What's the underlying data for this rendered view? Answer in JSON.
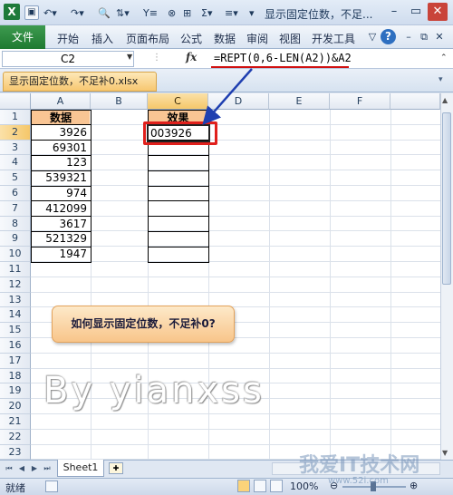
{
  "window": {
    "title": "显示固定位数，不足...",
    "app_icon": "excel-logo",
    "qa_icons": [
      "save-icon",
      "undo-icon",
      "redo-icon",
      "print-preview-icon",
      "sort-icon",
      "filter-icon",
      "borders-icon",
      "autosum-icon",
      "merge-icon"
    ]
  },
  "ribbon": {
    "file": "文件",
    "tabs": [
      "开始",
      "插入",
      "页面布局",
      "公式",
      "数据",
      "审阅",
      "视图",
      "开发工具"
    ]
  },
  "formula_bar": {
    "name_box": "C2",
    "fx": "fx",
    "formula": "=REPT(0,6-LEN(A2))&A2"
  },
  "workbook_tab": "显示固定位数，不足补0.xlsx",
  "columns": [
    "A",
    "B",
    "C",
    "D",
    "E",
    "F"
  ],
  "rows": [
    "1",
    "2",
    "3",
    "4",
    "5",
    "6",
    "7",
    "8",
    "9",
    "10",
    "11",
    "12",
    "13",
    "14",
    "15",
    "16",
    "17",
    "18",
    "19",
    "20",
    "21",
    "22",
    "23"
  ],
  "sheet": {
    "header_a": "数据",
    "header_c": "效果",
    "data": [
      "3926",
      "69301",
      "123",
      "539321",
      "974",
      "412099",
      "3617",
      "521329",
      "1947"
    ],
    "c2": "003926"
  },
  "callout": "如何显示固定位数，不足补0?",
  "watermark": "By yianxss",
  "sheet_tabs": {
    "active": "Sheet1"
  },
  "status": {
    "ready": "就绪",
    "zoom": "100%"
  },
  "site_watermark": {
    "text": "我爱IT技术网",
    "url": "www.52i.com"
  },
  "colors": {
    "header_fill": "#f9c594",
    "selection": "#e0201c",
    "arrow": "#1f3fb0"
  }
}
